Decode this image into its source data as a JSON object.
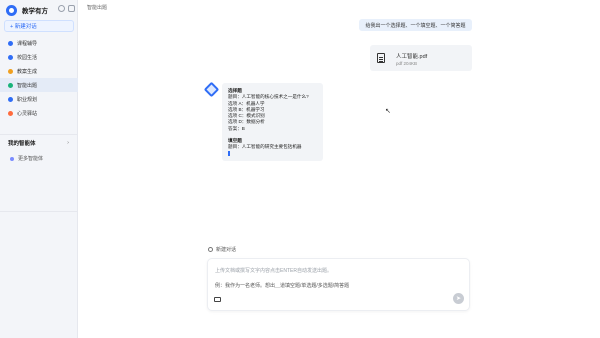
{
  "brand": {
    "title": "教学有方"
  },
  "sidebar": {
    "new_chat": "+ 新建对话",
    "items": [
      {
        "label": "课程辅导",
        "color": "#2f6df6"
      },
      {
        "label": "校园生活",
        "color": "#2f6df6"
      },
      {
        "label": "教案生成",
        "color": "#f0a020"
      },
      {
        "label": "智能出题",
        "color": "#19b37a"
      },
      {
        "label": "职业规划",
        "color": "#2f6df6"
      },
      {
        "label": "心灵驿站",
        "color": "#ff6b3d"
      }
    ],
    "section_title": "我的智能体",
    "more_label": "更多智能体"
  },
  "main": {
    "tab_label": "智能出题",
    "user_message": "给我出一个选择题、一个填空题、一个简答题",
    "file": {
      "name": "人工智能.pdf",
      "meta": "pdf  204KB"
    },
    "answer": {
      "h1": "选择题",
      "q1": "题目：人工智能的核心技术之一是什么?",
      "a": "选项 A：机器人学",
      "b": "选项 B：机器学习",
      "c": "选项 C：模式识别",
      "d": "选项 D：数据分析",
      "ans": "答案：B",
      "h2": "填空题",
      "q2": "题目：人工智能的研究主要包括机器"
    },
    "new_chat_tip": "新建对话",
    "composer": {
      "placeholder": "上传文档或撰写文字内容点击ENTER自动发送出题。",
      "example": "例：我作为一名老师。想出＿道填空题/单选题/多选题/简答题"
    }
  }
}
